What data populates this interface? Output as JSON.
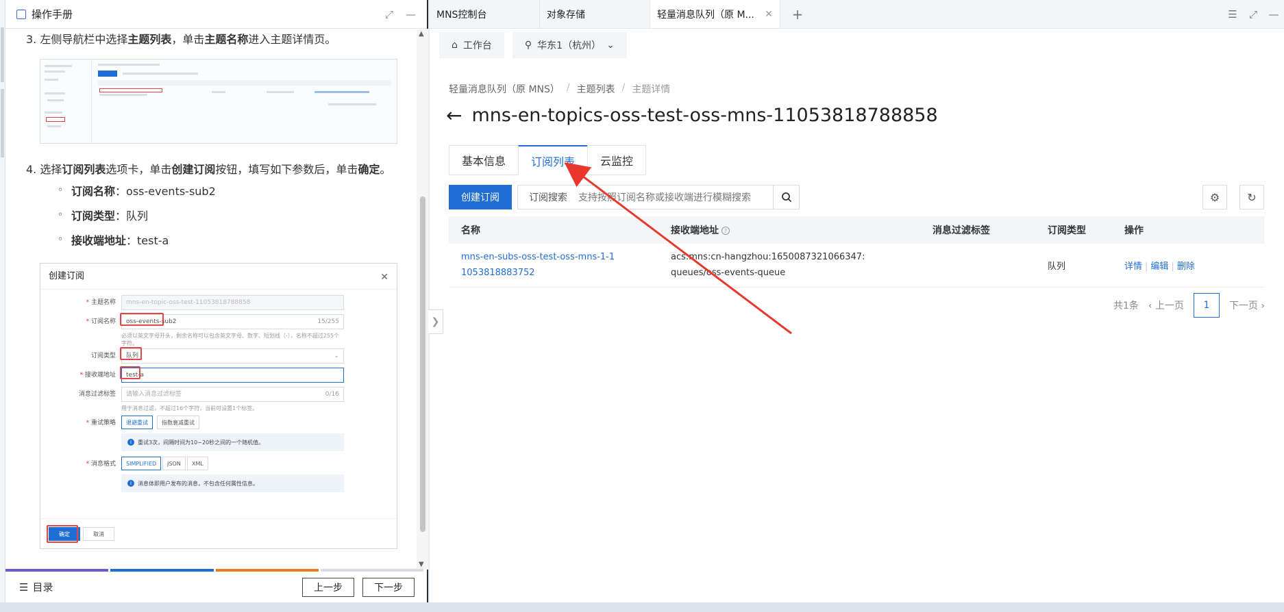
{
  "left_panel": {
    "title": "操作手册",
    "step3": {
      "num": "3.",
      "t1": "左侧导航栏中选择",
      "b1": "主题列表",
      "t2": "，单击",
      "b2": "主题名称",
      "t3": "进入主题详情页。"
    },
    "step4": {
      "num": "4.",
      "t1": "选择",
      "b1": "订阅列表",
      "t2": "选项卡，单击",
      "b2": "创建订阅",
      "t3": "按钮，填写如下参数后，单击",
      "b3": "确定",
      "t4": "。"
    },
    "params": [
      {
        "label": "订阅名称",
        "value": "oss-events-sub2"
      },
      {
        "label": "订阅类型",
        "value": "队列"
      },
      {
        "label": "接收端地址",
        "value": "test-a"
      }
    ],
    "dialog": {
      "title": "创建订阅",
      "topic_label": "主题名称",
      "topic_value": "mns-en-topic-oss-test-11053818788858",
      "name_label": "订阅名称",
      "name_value": "oss-events-sub2",
      "name_count": "15/255",
      "name_hint": "必须以英文字母开头，剩余名称可以包含英文字母、数字、短划线（-），名称不超过255个字符。",
      "type_label": "订阅类型",
      "type_value": "队列",
      "endpoint_label": "接收端地址",
      "endpoint_value": "test-a",
      "filter_label": "消息过滤标签",
      "filter_placeholder": "请输入消息过滤标签",
      "filter_count": "0/16",
      "filter_hint": "用于消息过滤，不超过16个字符，当前可设置1个标签。",
      "retry_label": "重试策略",
      "retry_options": [
        "退避重试",
        "指数衰减重试"
      ],
      "retry_info": "重试3次，间隔时间为10~20秒之间的一个随机值。",
      "format_label": "消息格式",
      "format_options": [
        "SIMPLIFIED",
        "JSON",
        "XML"
      ],
      "format_info": "消息体即用户发布的消息，不包含任何属性信息。",
      "ok": "确定",
      "cancel": "取消"
    },
    "footer": {
      "toc": "目录",
      "prev": "上一步",
      "next": "下一步"
    },
    "progress_colors": [
      "#6a5acd",
      "#1f6ed4",
      "#f07a24",
      "#d9dde3"
    ]
  },
  "tabs": [
    {
      "label": "MNS控制台"
    },
    {
      "label": "对象存储"
    },
    {
      "label": "轻量消息队列（原 M..."
    }
  ],
  "top_nav": {
    "workbench": "工作台",
    "region": "华东1（杭州）"
  },
  "breadcrumb": [
    "轻量消息队列（原 MNS）",
    "主题列表",
    "主题详情"
  ],
  "page_title": "mns-en-topics-oss-test-oss-mns-11053818788858",
  "detail_tabs": [
    "基本信息",
    "订阅列表",
    "云监控"
  ],
  "toolbar": {
    "create": "创建订阅",
    "search_label": "订阅搜索",
    "search_placeholder": "支持按照订阅名称或接收端进行模糊搜索"
  },
  "table": {
    "headers": [
      "名称",
      "接收端地址",
      "消息过滤标签",
      "订阅类型",
      "操作"
    ],
    "row": {
      "name": "mns-en-subs-oss-test-oss-mns-1-11053818883752",
      "endpoint": "acs:mns:cn-hangzhou:1650087321066347:queues/oss-events-queue",
      "tag": "",
      "type": "队列",
      "actions": [
        "详情",
        "编辑",
        "删除"
      ]
    }
  },
  "pagination": {
    "total": "共1条",
    "prev": "上一页",
    "page": "1",
    "next": "下一页"
  },
  "colors": {
    "primary": "#1f6ed4",
    "annotation": "#e8372c"
  }
}
